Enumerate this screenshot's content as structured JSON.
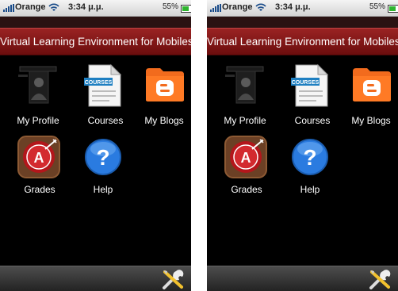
{
  "screens": [
    {
      "status": {
        "carrier": "Orange",
        "time": "3:34 μ.μ.",
        "battery": "55%",
        "battery_level": 0.55
      },
      "title": "Virtual Learning Environment for Mobiles",
      "apps": [
        {
          "label": "My Profile",
          "icon": "profile-icon"
        },
        {
          "label": "Courses",
          "icon": "courses-icon",
          "badge": "COURSES"
        },
        {
          "label": "My Blogs",
          "icon": "blog-icon"
        },
        {
          "label": "Grades",
          "icon": "grades-icon",
          "badge": "A"
        },
        {
          "label": "Help",
          "icon": "help-icon",
          "badge": "?"
        }
      ],
      "toolbar": {
        "icon": "tools-icon"
      }
    },
    {
      "status": {
        "carrier": "Orange",
        "time": "3:34 μ.μ.",
        "battery": "55%",
        "battery_level": 0.55
      },
      "title": "Virtual Learning Environment for Mobiles",
      "apps": [
        {
          "label": "My Profile",
          "icon": "profile-icon"
        },
        {
          "label": "Courses",
          "icon": "courses-icon",
          "badge": "COURSES"
        },
        {
          "label": "My Blogs",
          "icon": "blog-icon"
        },
        {
          "label": "Grades",
          "icon": "grades-icon",
          "badge": "A"
        },
        {
          "label": "Help",
          "icon": "help-icon",
          "badge": "?"
        }
      ],
      "toolbar": {
        "icon": "tools-icon"
      }
    }
  ],
  "colors": {
    "title_bar": "#8b1a1a",
    "background": "#000000",
    "blog": "#f26b1d",
    "help": "#2a7be0",
    "grades": "#b3161b"
  }
}
